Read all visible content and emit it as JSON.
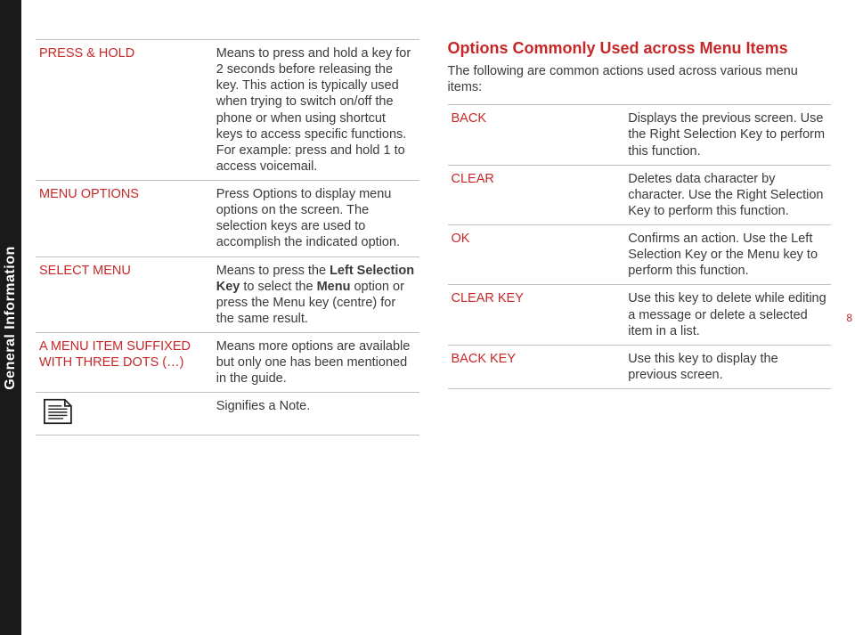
{
  "sidebar": {
    "label": "General Information"
  },
  "page_number": "8",
  "left_table": [
    {
      "term": "PRESS & HOLD",
      "desc_parts": [
        {
          "text": "Means to press and hold a key for 2 seconds before releasing the key. This action is typically used when trying to switch on/off the phone or when using shortcut keys to access specific functions. For example: press and hold 1 to access voicemail.",
          "bold": false
        }
      ]
    },
    {
      "term": "MENU OPTIONS",
      "desc_parts": [
        {
          "text": "Press Options to display menu options on the screen. The selection keys are used to accomplish the indicated option.",
          "bold": false
        }
      ]
    },
    {
      "term": "SELECT MENU",
      "desc_parts": [
        {
          "text": "Means to press the ",
          "bold": false
        },
        {
          "text": "Left Selection Key",
          "bold": true
        },
        {
          "text": " to select the ",
          "bold": false
        },
        {
          "text": "Menu",
          "bold": true
        },
        {
          "text": " option or press the Menu key (centre) for the same result.",
          "bold": false
        }
      ]
    },
    {
      "term": "A MENU ITEM SUFFIXED WITH THREE DOTS (…)",
      "desc_parts": [
        {
          "text": "Means more options are available but only one has been mentioned in the guide.",
          "bold": false
        }
      ]
    },
    {
      "term": "__NOTE_ICON__",
      "desc_parts": [
        {
          "text": "Signifies a Note.",
          "bold": false
        }
      ]
    }
  ],
  "right_section": {
    "heading": "Options Commonly Used across Menu Items",
    "intro": "The following are common actions used across various menu items:",
    "table": [
      {
        "term": "BACK",
        "desc": "Displays the previous screen. Use the Right Selection Key to perform this function."
      },
      {
        "term": "CLEAR",
        "desc": "Deletes data character by character. Use the Right Selection Key to perform this function."
      },
      {
        "term": "OK",
        "desc": "Confirms an action. Use the Left Selection Key or the Menu key to perform this function."
      },
      {
        "term": "CLEAR KEY",
        "desc": "Use this key to delete while editing a message or delete a selected item in a list."
      },
      {
        "term": "BACK KEY",
        "desc": "Use this key to display the previous screen."
      }
    ]
  }
}
